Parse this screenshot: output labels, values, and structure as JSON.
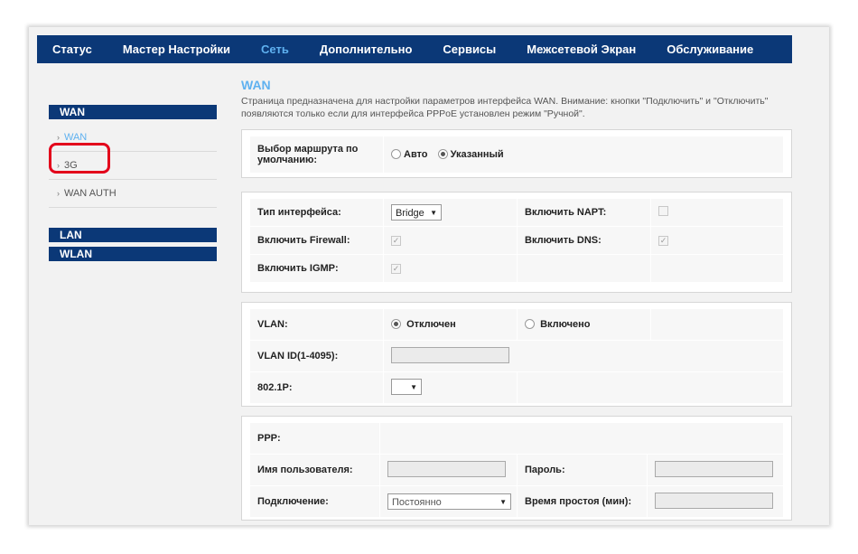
{
  "nav": {
    "tabs": [
      {
        "label": "Статус"
      },
      {
        "label": "Мастер Настройки"
      },
      {
        "label": "Сеть"
      },
      {
        "label": "Дополнительно"
      },
      {
        "label": "Сервисы"
      },
      {
        "label": "Межсетевой Экран"
      },
      {
        "label": "Обслуживание"
      }
    ],
    "active_tab": "Сеть"
  },
  "sidebar": {
    "wan_header": "WAN",
    "wan_items": [
      {
        "label": "WAN"
      },
      {
        "label": "3G"
      },
      {
        "label": "WAN AUTH"
      }
    ],
    "lan_header": "LAN",
    "wlan_header": "WLAN"
  },
  "page": {
    "title": "WAN",
    "description": "Страница предназначена для настройки параметров интерфейса WAN. Внимание: кнопки \"Подключить\" и \"Отключить\" появляются только если для интерфейса PPPoE установлен режим \"Ручной\"."
  },
  "route": {
    "label": "Выбор маршрута по умолчанию:",
    "option_auto": "Авто",
    "option_manual": "Указанный",
    "selected": "Указанный"
  },
  "interface": {
    "type_label": "Тип интерфейса:",
    "type_value": "Bridge",
    "napt_label": "Включить NAPT:",
    "firewall_label": "Включить Firewall:",
    "dns_label": "Включить DNS:",
    "igmp_label": "Включить IGMP:"
  },
  "vlan": {
    "label": "VLAN:",
    "option_off": "Отключен",
    "option_on": "Включено",
    "selected": "Отключен",
    "id_label": "VLAN ID(1-4095):",
    "p_label": "802.1P:"
  },
  "ppp": {
    "label": "PPP:",
    "user_label": "Имя пользователя:",
    "password_label": "Пароль:",
    "connection_label": "Подключение:",
    "connection_value": "Постоянно",
    "idle_label": "Время простоя (мин):"
  }
}
